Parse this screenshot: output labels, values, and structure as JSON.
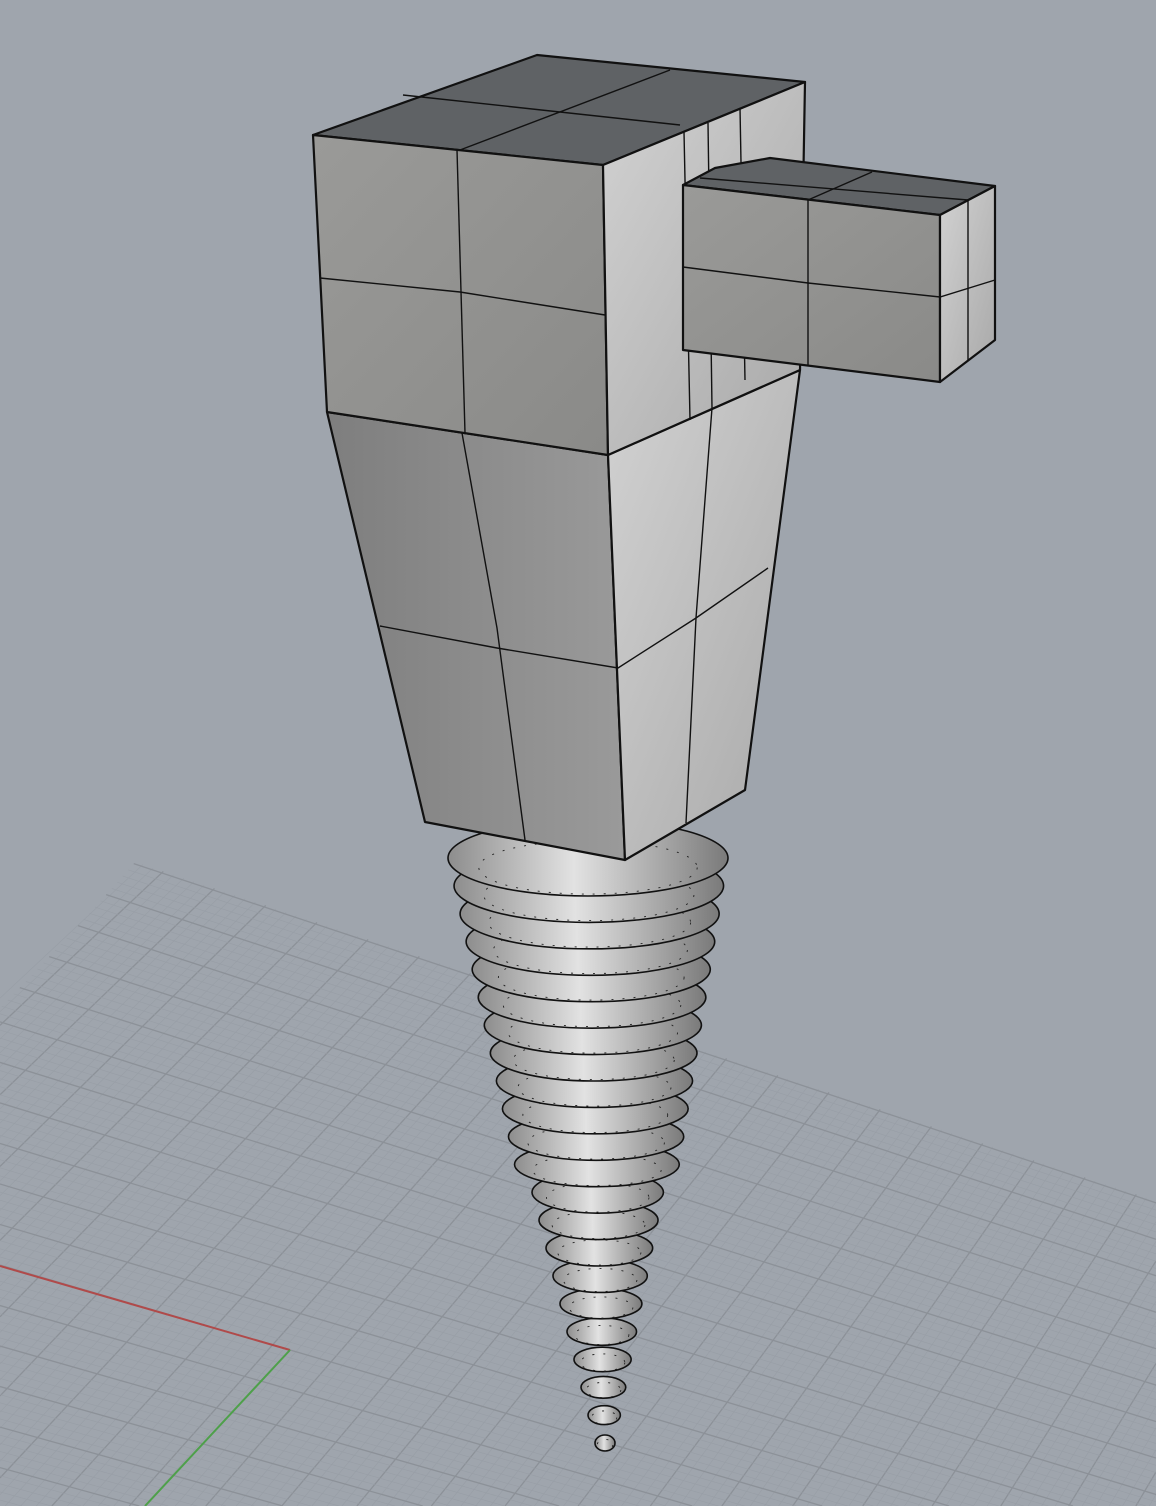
{
  "viewport": {
    "background": "#9fa5ad",
    "grid_major_color": "#8c9198",
    "grid_minor_color": "#989ea6",
    "x_axis_color": "#b04a4a",
    "y_axis_color": "#4ea04a",
    "shade_top": "#5f6265",
    "shade_front": "#8e8e8c",
    "shade_side": "#c6c6c6",
    "screw_fill": "#b9b9b9"
  }
}
